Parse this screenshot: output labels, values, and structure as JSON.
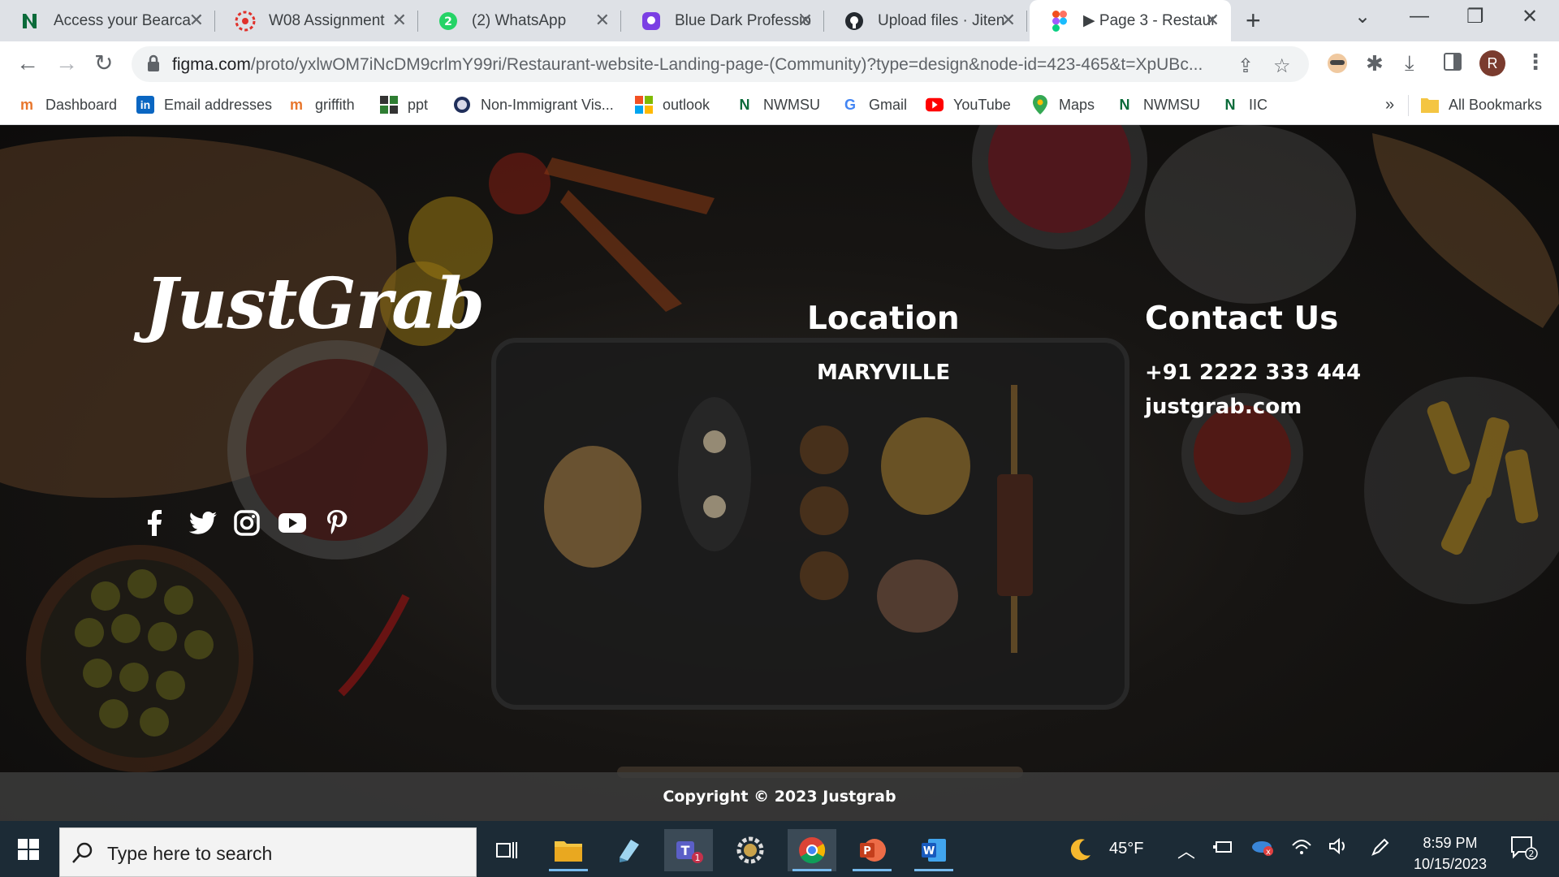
{
  "browser": {
    "tabs": [
      {
        "title": "Access your Bearca",
        "icon": "nwmsu-icon"
      },
      {
        "title": "W08 Assignment",
        "icon": "canvas-icon"
      },
      {
        "title": "(2) WhatsApp",
        "icon": "whatsapp-icon",
        "badge": "2"
      },
      {
        "title": "Blue Dark Professio",
        "icon": "canva-icon"
      },
      {
        "title": "Upload files · Jiten",
        "icon": "github-icon"
      },
      {
        "title": "▶ Page 3 - Restaur",
        "icon": "figma-icon",
        "active": true
      }
    ],
    "url_host": "figma.com",
    "url_path": "/proto/yxlwOM7iNcDM9crlmY99ri/Restaurant-website-Landing-page-(Community)?type=design&node-id=423-465&t=XpUBc...",
    "profile_initial": "R",
    "bookmarks": [
      {
        "label": "Dashboard",
        "icon": "griffith-icon"
      },
      {
        "label": "Email addresses",
        "icon": "linkedin-icon"
      },
      {
        "label": "griffith",
        "icon": "griffith-icon"
      },
      {
        "label": "ppt",
        "icon": "ppt-icon"
      },
      {
        "label": "Non-Immigrant Vis...",
        "icon": "seal-icon"
      },
      {
        "label": "outlook",
        "icon": "microsoft-icon"
      },
      {
        "label": "NWMSU",
        "icon": "nwmsu-icon"
      },
      {
        "label": "Gmail",
        "icon": "google-icon"
      },
      {
        "label": "YouTube",
        "icon": "youtube-icon"
      },
      {
        "label": "Maps",
        "icon": "maps-icon"
      },
      {
        "label": "NWMSU",
        "icon": "nwmsu-icon"
      },
      {
        "label": "IIC",
        "icon": "nwmsu-icon"
      }
    ],
    "bookmarks_overflow": "»",
    "all_bookmarks": "All Bookmarks"
  },
  "site": {
    "logo": "JustGrab",
    "location_heading": "Location",
    "location_value": "MARYVILLE",
    "contact_heading": "Contact Us",
    "phone": "+91 2222 333 444",
    "website": "justgrab.com",
    "social": [
      "facebook-icon",
      "twitter-icon",
      "instagram-icon",
      "youtube-icon",
      "pinterest-icon"
    ],
    "copyright": "Copyright © 2023 Justgrab"
  },
  "taskbar": {
    "search_placeholder": "Type here to search",
    "weather": "45°F",
    "time": "8:59 PM",
    "date": "10/15/2023",
    "notification_count": "2",
    "teams_badge": "1"
  },
  "colors": {
    "tabstrip": "#dee1e6",
    "taskbar": "#1c2b36",
    "page_text": "#ffffff"
  }
}
